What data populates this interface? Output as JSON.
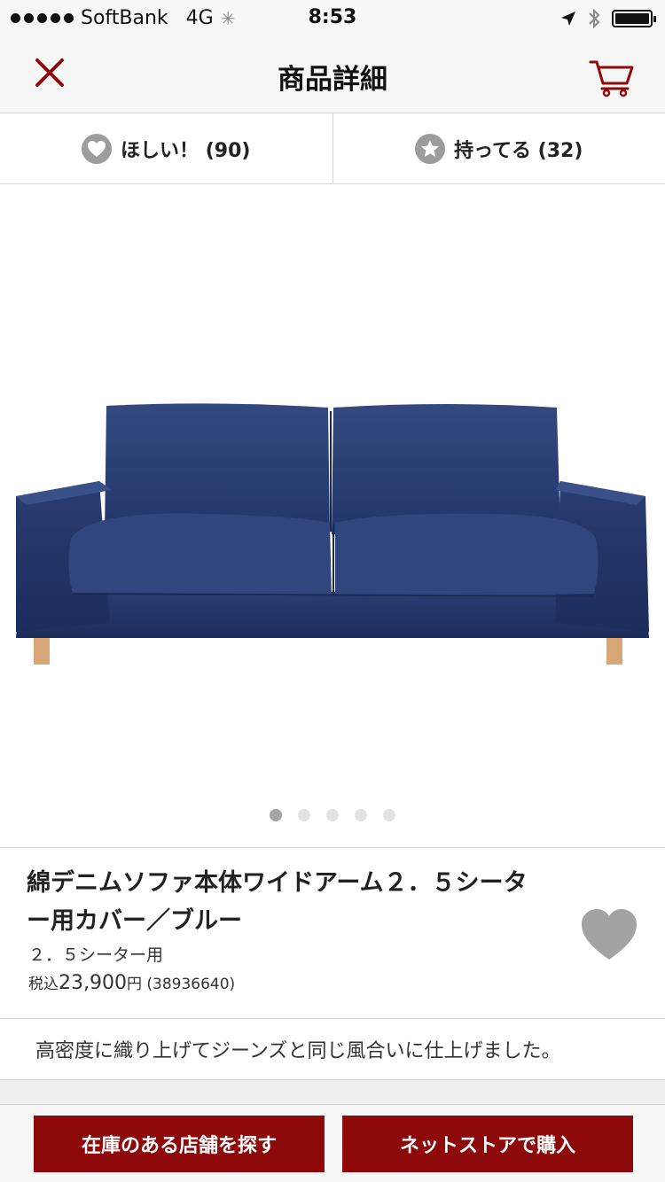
{
  "status_bar": {
    "carrier": "SoftBank",
    "network": "4G",
    "time": "8:53"
  },
  "nav": {
    "title": "商品詳細"
  },
  "want_have": {
    "want_label": "ほしい！ (90)",
    "have_label": "持ってる (32)"
  },
  "carousel": {
    "page_count": 5,
    "active_index": 0
  },
  "product": {
    "name_line1": "綿デニムソファ本体ワイドアーム２．５シータ",
    "name_line2": "ー用カバー／ブルー",
    "variant": "２．５シーター用",
    "price_prefix": "税込",
    "price_value": "23,900",
    "price_unit": "円",
    "product_code": "(38936640)"
  },
  "description": "高密度に織り上げてジーンズと同じ風合いに仕上げました。",
  "actions": {
    "find_store": "在庫のある店舗を探す",
    "buy_online": "ネットストアで購入"
  },
  "colors": {
    "accent": "#8e0a0a",
    "icon_gray": "#9c9c9c",
    "sofa": "#2b3f74"
  }
}
